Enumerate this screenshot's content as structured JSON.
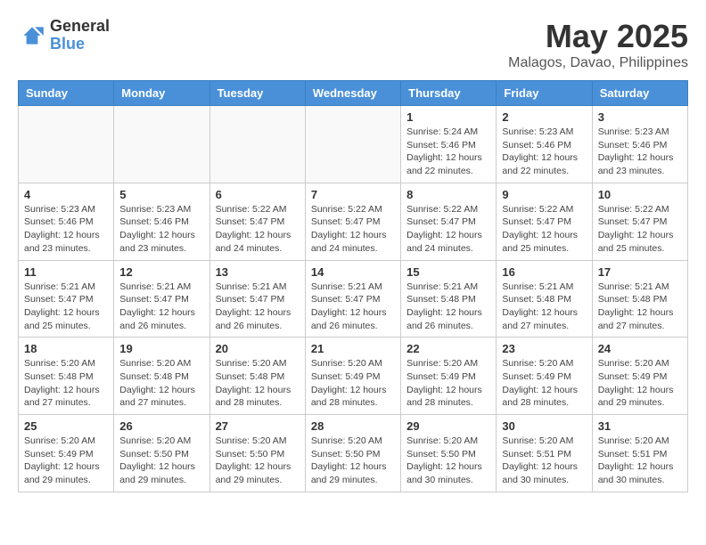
{
  "logo": {
    "general": "General",
    "blue": "Blue"
  },
  "title": "May 2025",
  "location": "Malagos, Davao, Philippines",
  "weekdays": [
    "Sunday",
    "Monday",
    "Tuesday",
    "Wednesday",
    "Thursday",
    "Friday",
    "Saturday"
  ],
  "weeks": [
    [
      {
        "day": "",
        "info": ""
      },
      {
        "day": "",
        "info": ""
      },
      {
        "day": "",
        "info": ""
      },
      {
        "day": "",
        "info": ""
      },
      {
        "day": "1",
        "info": "Sunrise: 5:24 AM\nSunset: 5:46 PM\nDaylight: 12 hours\nand 22 minutes."
      },
      {
        "day": "2",
        "info": "Sunrise: 5:23 AM\nSunset: 5:46 PM\nDaylight: 12 hours\nand 22 minutes."
      },
      {
        "day": "3",
        "info": "Sunrise: 5:23 AM\nSunset: 5:46 PM\nDaylight: 12 hours\nand 23 minutes."
      }
    ],
    [
      {
        "day": "4",
        "info": "Sunrise: 5:23 AM\nSunset: 5:46 PM\nDaylight: 12 hours\nand 23 minutes."
      },
      {
        "day": "5",
        "info": "Sunrise: 5:23 AM\nSunset: 5:46 PM\nDaylight: 12 hours\nand 23 minutes."
      },
      {
        "day": "6",
        "info": "Sunrise: 5:22 AM\nSunset: 5:47 PM\nDaylight: 12 hours\nand 24 minutes."
      },
      {
        "day": "7",
        "info": "Sunrise: 5:22 AM\nSunset: 5:47 PM\nDaylight: 12 hours\nand 24 minutes."
      },
      {
        "day": "8",
        "info": "Sunrise: 5:22 AM\nSunset: 5:47 PM\nDaylight: 12 hours\nand 24 minutes."
      },
      {
        "day": "9",
        "info": "Sunrise: 5:22 AM\nSunset: 5:47 PM\nDaylight: 12 hours\nand 25 minutes."
      },
      {
        "day": "10",
        "info": "Sunrise: 5:22 AM\nSunset: 5:47 PM\nDaylight: 12 hours\nand 25 minutes."
      }
    ],
    [
      {
        "day": "11",
        "info": "Sunrise: 5:21 AM\nSunset: 5:47 PM\nDaylight: 12 hours\nand 25 minutes."
      },
      {
        "day": "12",
        "info": "Sunrise: 5:21 AM\nSunset: 5:47 PM\nDaylight: 12 hours\nand 26 minutes."
      },
      {
        "day": "13",
        "info": "Sunrise: 5:21 AM\nSunset: 5:47 PM\nDaylight: 12 hours\nand 26 minutes."
      },
      {
        "day": "14",
        "info": "Sunrise: 5:21 AM\nSunset: 5:47 PM\nDaylight: 12 hours\nand 26 minutes."
      },
      {
        "day": "15",
        "info": "Sunrise: 5:21 AM\nSunset: 5:48 PM\nDaylight: 12 hours\nand 26 minutes."
      },
      {
        "day": "16",
        "info": "Sunrise: 5:21 AM\nSunset: 5:48 PM\nDaylight: 12 hours\nand 27 minutes."
      },
      {
        "day": "17",
        "info": "Sunrise: 5:21 AM\nSunset: 5:48 PM\nDaylight: 12 hours\nand 27 minutes."
      }
    ],
    [
      {
        "day": "18",
        "info": "Sunrise: 5:20 AM\nSunset: 5:48 PM\nDaylight: 12 hours\nand 27 minutes."
      },
      {
        "day": "19",
        "info": "Sunrise: 5:20 AM\nSunset: 5:48 PM\nDaylight: 12 hours\nand 27 minutes."
      },
      {
        "day": "20",
        "info": "Sunrise: 5:20 AM\nSunset: 5:48 PM\nDaylight: 12 hours\nand 28 minutes."
      },
      {
        "day": "21",
        "info": "Sunrise: 5:20 AM\nSunset: 5:49 PM\nDaylight: 12 hours\nand 28 minutes."
      },
      {
        "day": "22",
        "info": "Sunrise: 5:20 AM\nSunset: 5:49 PM\nDaylight: 12 hours\nand 28 minutes."
      },
      {
        "day": "23",
        "info": "Sunrise: 5:20 AM\nSunset: 5:49 PM\nDaylight: 12 hours\nand 28 minutes."
      },
      {
        "day": "24",
        "info": "Sunrise: 5:20 AM\nSunset: 5:49 PM\nDaylight: 12 hours\nand 29 minutes."
      }
    ],
    [
      {
        "day": "25",
        "info": "Sunrise: 5:20 AM\nSunset: 5:49 PM\nDaylight: 12 hours\nand 29 minutes."
      },
      {
        "day": "26",
        "info": "Sunrise: 5:20 AM\nSunset: 5:50 PM\nDaylight: 12 hours\nand 29 minutes."
      },
      {
        "day": "27",
        "info": "Sunrise: 5:20 AM\nSunset: 5:50 PM\nDaylight: 12 hours\nand 29 minutes."
      },
      {
        "day": "28",
        "info": "Sunrise: 5:20 AM\nSunset: 5:50 PM\nDaylight: 12 hours\nand 29 minutes."
      },
      {
        "day": "29",
        "info": "Sunrise: 5:20 AM\nSunset: 5:50 PM\nDaylight: 12 hours\nand 30 minutes."
      },
      {
        "day": "30",
        "info": "Sunrise: 5:20 AM\nSunset: 5:51 PM\nDaylight: 12 hours\nand 30 minutes."
      },
      {
        "day": "31",
        "info": "Sunrise: 5:20 AM\nSunset: 5:51 PM\nDaylight: 12 hours\nand 30 minutes."
      }
    ]
  ]
}
